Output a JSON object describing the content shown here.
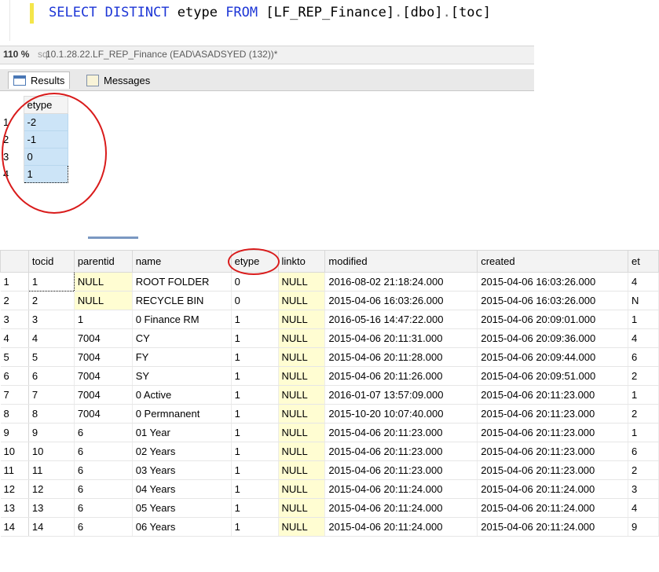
{
  "editor": {
    "sql_parts": [
      "SELECT DISTINCT",
      " etype ",
      "FROM",
      " [LF_REP_Finance]",
      ".",
      "[dbo]",
      ".",
      "[toc]"
    ]
  },
  "status": {
    "zoom": "110 %",
    "connection": "10.1.28.22.LF_REP_Finance (EAD\\ASADSYED (132))*",
    "tab_fragment": "sql"
  },
  "tabs": [
    {
      "label": "Results",
      "icon": "results-grid-icon"
    },
    {
      "label": "Messages",
      "icon": "messages-icon"
    }
  ],
  "top_grid": {
    "header": "etype",
    "rows": [
      {
        "row": "1",
        "value": "-2"
      },
      {
        "row": "2",
        "value": "-1"
      },
      {
        "row": "3",
        "value": "0"
      },
      {
        "row": "4",
        "value": "1"
      }
    ]
  },
  "bottom_grid": {
    "columns": [
      "tocid",
      "parentid",
      "name",
      "etype",
      "linkto",
      "modified",
      "created",
      "et"
    ],
    "rows": [
      [
        "1",
        "1",
        "NULL",
        "ROOT FOLDER",
        "0",
        "NULL",
        "2016-08-02 21:18:24.000",
        "2015-04-06 16:03:26.000",
        "4"
      ],
      [
        "2",
        "2",
        "NULL",
        "RECYCLE BIN",
        "0",
        "NULL",
        "2015-04-06 16:03:26.000",
        "2015-04-06 16:03:26.000",
        "N"
      ],
      [
        "3",
        "3",
        "1",
        "0 Finance RM",
        "1",
        "NULL",
        "2016-05-16 14:47:22.000",
        "2015-04-06 20:09:01.000",
        "1"
      ],
      [
        "4",
        "4",
        "7004",
        "CY",
        "1",
        "NULL",
        "2015-04-06 20:11:31.000",
        "2015-04-06 20:09:36.000",
        "4"
      ],
      [
        "5",
        "5",
        "7004",
        "FY",
        "1",
        "NULL",
        "2015-04-06 20:11:28.000",
        "2015-04-06 20:09:44.000",
        "6"
      ],
      [
        "6",
        "6",
        "7004",
        "SY",
        "1",
        "NULL",
        "2015-04-06 20:11:26.000",
        "2015-04-06 20:09:51.000",
        "2"
      ],
      [
        "7",
        "7",
        "7004",
        "0 Active",
        "1",
        "NULL",
        "2016-01-07 13:57:09.000",
        "2015-04-06 20:11:23.000",
        "1"
      ],
      [
        "8",
        "8",
        "7004",
        "0 Permnanent",
        "1",
        "NULL",
        "2015-10-20 10:07:40.000",
        "2015-04-06 20:11:23.000",
        "2"
      ],
      [
        "9",
        "9",
        "6",
        "01 Year",
        "1",
        "NULL",
        "2015-04-06 20:11:23.000",
        "2015-04-06 20:11:23.000",
        "1"
      ],
      [
        "10",
        "10",
        "6",
        "02 Years",
        "1",
        "NULL",
        "2015-04-06 20:11:23.000",
        "2015-04-06 20:11:23.000",
        "6"
      ],
      [
        "11",
        "11",
        "6",
        "03 Years",
        "1",
        "NULL",
        "2015-04-06 20:11:23.000",
        "2015-04-06 20:11:23.000",
        "2"
      ],
      [
        "12",
        "12",
        "6",
        "04 Years",
        "1",
        "NULL",
        "2015-04-06 20:11:24.000",
        "2015-04-06 20:11:24.000",
        "3"
      ],
      [
        "13",
        "13",
        "6",
        "05 Years",
        "1",
        "NULL",
        "2015-04-06 20:11:24.000",
        "2015-04-06 20:11:24.000",
        "4"
      ],
      [
        "14",
        "14",
        "6",
        "06 Years",
        "1",
        "NULL",
        "2015-04-06 20:11:24.000",
        "2015-04-06 20:11:24.000",
        "9"
      ]
    ]
  },
  "colors": {
    "keyword": "#1d36d6",
    "selection": "#cce4f7",
    "null_cell": "#fffdd2",
    "annotation": "#d91b1b"
  }
}
